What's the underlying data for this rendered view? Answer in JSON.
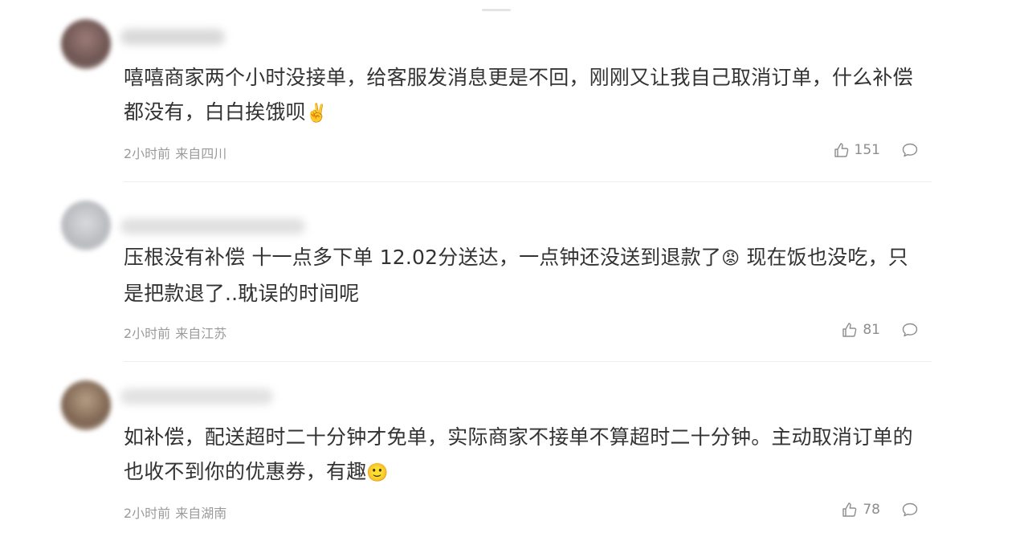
{
  "comments": [
    {
      "text": "嘻嘻商家两个小时没接单，给客服发消息更是不回，刚刚又让我自己取消订单，什么补偿都没有，白白挨饿呗",
      "emoji": "✌️",
      "time": "2小时前",
      "location": "来自四川",
      "likes": "151"
    },
    {
      "text": "压根没有补偿 十一点多下单 12.02分送达，一点钟还没送到退款了",
      "emoji": "😡",
      "text_after": " 现在饭也没吃，只是把款退了..耽误的时间呢",
      "time": "2小时前",
      "location": "来自江苏",
      "likes": "81"
    },
    {
      "text": "如补偿，配送超时二十分钟才免单，实际商家不接单不算超时二十分钟。主动取消订单的也收不到你的优惠券，有趣",
      "emoji": "🙂",
      "time": "2小时前",
      "location": "来自湖南",
      "likes": "78"
    }
  ],
  "icons": {
    "like": "thumbs-up-icon",
    "reply": "comment-bubble-icon"
  }
}
